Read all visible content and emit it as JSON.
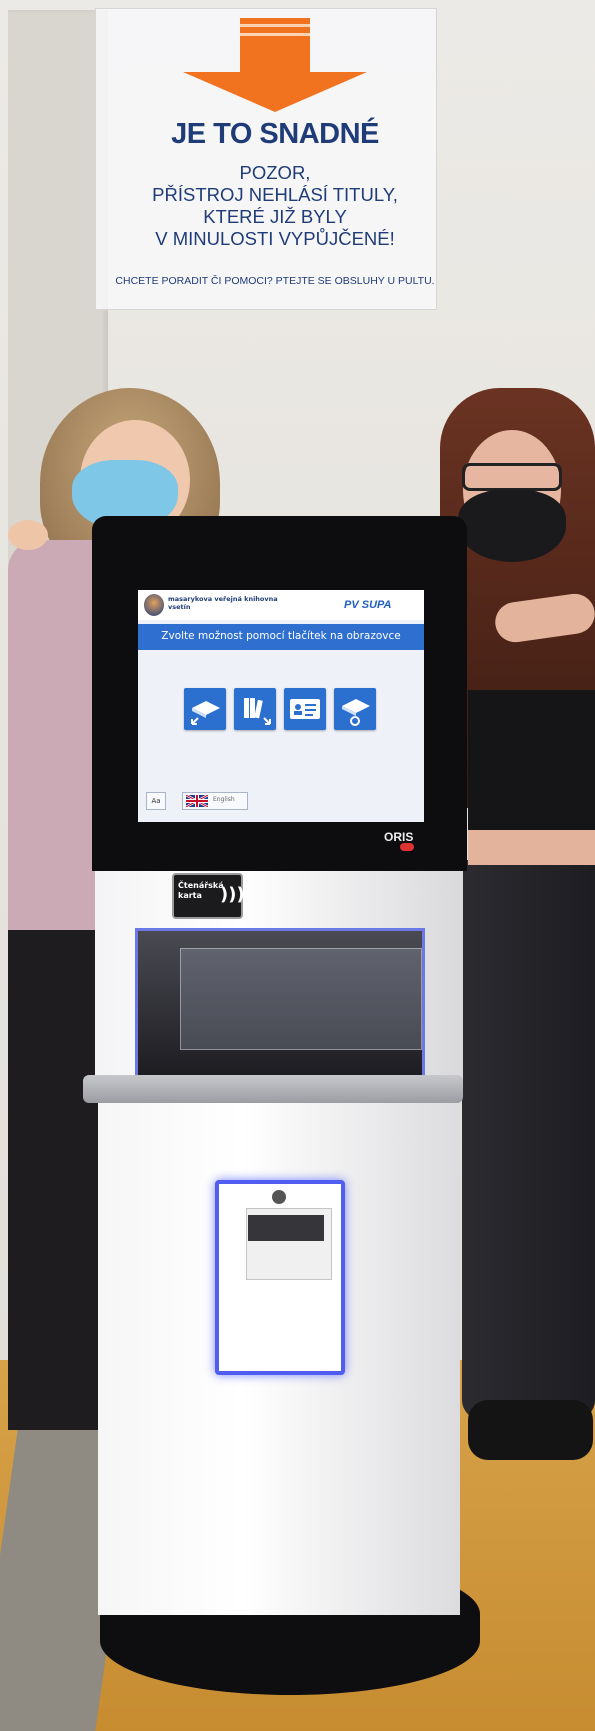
{
  "poster": {
    "title": "JE TO SNADNÉ",
    "line1": "POZOR,",
    "line2": "PŘÍSTROJ NEHLÁSÍ TITULY,",
    "line3": "KTERÉ JIŽ BYLY",
    "line4": "V MINULOSTI VYPŮJČENÉ!",
    "footer": "CHCETE PORADIT ČI POMOCI? PTEJTE SE OBSLUHY U PULTU.",
    "arrow_color": "#f1731f",
    "text_color": "#1f3c78"
  },
  "kiosk": {
    "screen": {
      "library_name": "masarykova veřejná knihovna vsetín",
      "brand": "PV SUPA",
      "prompt": "Zvolte možnost pomocí tlačítek na obrazovce",
      "tiles": [
        {
          "icon": "book-return-icon"
        },
        {
          "icon": "books-shelf-icon"
        },
        {
          "icon": "reader-account-icon"
        },
        {
          "icon": "book-renew-icon"
        }
      ],
      "a_button": "Aa",
      "language_button": "English",
      "accent": "#2f6fd0"
    },
    "manufacturer": "ORIS",
    "card_label": "Čtenářská karta"
  }
}
